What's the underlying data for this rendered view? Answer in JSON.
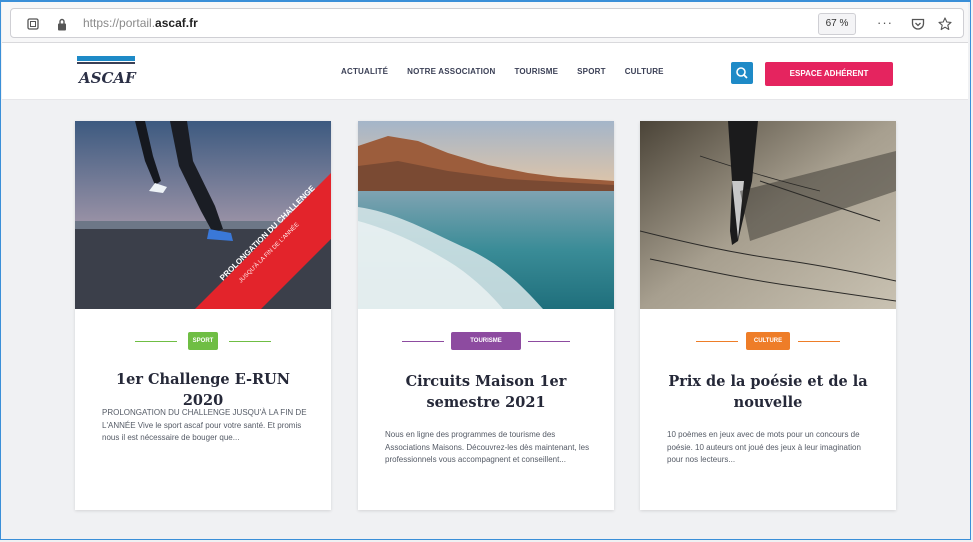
{
  "browser": {
    "url_prefix": "https://portail.",
    "url_domain": "ascaf.fr",
    "zoom": "67 %",
    "more": "···"
  },
  "site": {
    "logo_text": "ASCAF",
    "nav": [
      "ACTUALITÉ",
      "NOTRE ASSOCIATION",
      "TOURISME",
      "SPORT",
      "CULTURE"
    ],
    "member_button": "ESPACE ADHÉRENT"
  },
  "cards": [
    {
      "tag": "SPORT",
      "tag_color": "#6fbe44",
      "title": "1er Challenge E-RUN 2020",
      "text": "PROLONGATION DU CHALLENGE JUSQU'À LA FIN DE L'ANNÉE Vive le sport ascaf pour votre santé. Et promis nous il est nécessaire de bouger que...",
      "banner": "PROLONGATION DU CHALLENGE",
      "banner_sub": "JUSQU'À LA FIN DE L'ANNÉE"
    },
    {
      "tag": "TOURISME",
      "tag_color": "#8d4ba0",
      "title": "Circuits Maison 1er semestre 2021",
      "text": "Nous en ligne des programmes de tourisme des Associations Maisons. Découvrez-les dès maintenant, les professionnels vous accompagnent et conseillent..."
    },
    {
      "tag": "CULTURE",
      "tag_color": "#ee7d28",
      "title": "Prix de la poésie et de la nouvelle",
      "text": "10 poèmes en jeux avec de mots pour un concours de poésie. 10 auteurs ont joué des jeux à leur imagination pour nos lecteurs..."
    }
  ]
}
